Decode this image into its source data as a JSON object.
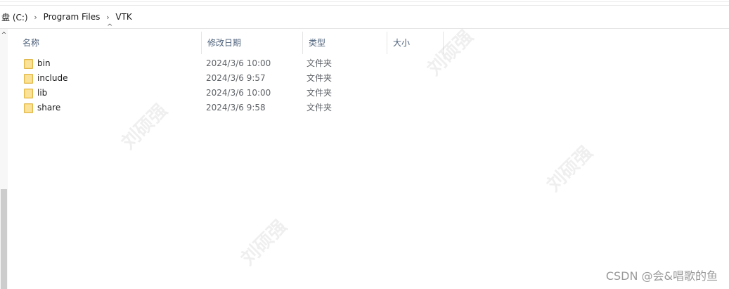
{
  "breadcrumb": {
    "items": [
      {
        "label": "盘 (C:)"
      },
      {
        "label": "Program Files"
      },
      {
        "label": "VTK"
      }
    ],
    "separator_icon": "chevron-right-icon"
  },
  "columns": {
    "name": "名称",
    "date": "修改日期",
    "type": "类型",
    "size": "大小",
    "sort_icon": "caret-up-icon"
  },
  "files": [
    {
      "name": "bin",
      "date": "2024/3/6 10:00",
      "type": "文件夹",
      "icon": "folder-icon"
    },
    {
      "name": "include",
      "date": "2024/3/6 9:57",
      "type": "文件夹",
      "icon": "folder-icon"
    },
    {
      "name": "lib",
      "date": "2024/3/6 10:00",
      "type": "文件夹",
      "icon": "folder-icon"
    },
    {
      "name": "share",
      "date": "2024/3/6 9:58",
      "type": "文件夹",
      "icon": "folder-icon"
    }
  ],
  "watermark": {
    "text": "刘硕强",
    "credit": "CSDN @会&唱歌的鱼"
  },
  "colors": {
    "folder": "#f8d775",
    "header_text": "#4c607a"
  }
}
